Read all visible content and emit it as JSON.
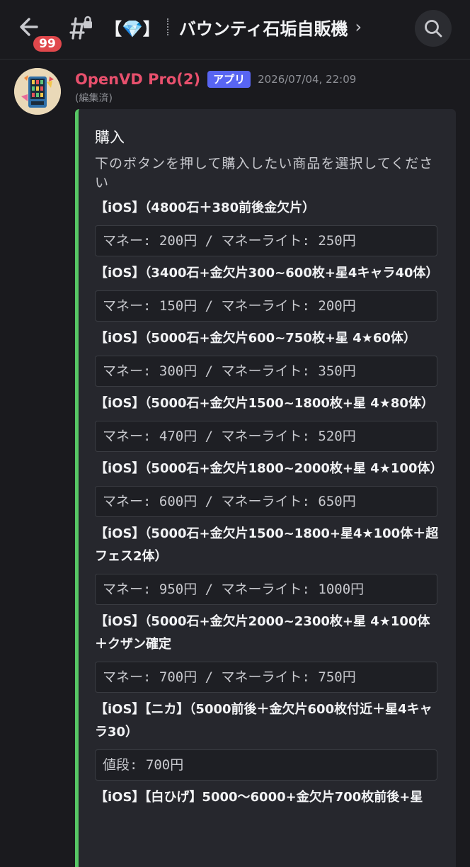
{
  "header": {
    "badge_count": "99",
    "channel_prefix": "【💎】",
    "channel_name": "バウンティ石垢自販機",
    "chevron": "›"
  },
  "message": {
    "author": "OpenVD Pro(2)",
    "app_tag": "アプリ",
    "timestamp": "2026/07/04, 22:09",
    "edited": "(編集済)"
  },
  "embed": {
    "accent_color": "#57c765",
    "title": "購入",
    "description": "下のボタンを押して購入したい商品を選択してください",
    "items": [
      {
        "label": "【iOS】（4800石＋380前後金欠片）",
        "price": "マネー: 200円 / マネーライト: 250円"
      },
      {
        "label": "【iOS】（3400石+金欠片300~600枚+星4キャラ40体）",
        "price": "マネー: 150円 / マネーライト: 200円"
      },
      {
        "label": "【iOS】（5000石+金欠片600~750枚+星 4★60体）",
        "price": "マネー: 300円 / マネーライト: 350円"
      },
      {
        "label": "【iOS】（5000石+金欠片1500~1800枚+星 4★80体）",
        "price": "マネー: 470円 / マネーライト: 520円"
      },
      {
        "label": "【iOS】（5000石+金欠片1800~2000枚+星 4★100体）",
        "price": "マネー: 600円 / マネーライト: 650円"
      },
      {
        "label": "【iOS】（5000石+金欠片1500~1800+星4★100体＋超フェス2体）",
        "price": "マネー: 950円 / マネーライト: 1000円"
      },
      {
        "label": "【iOS】（5000石+金欠片2000~2300枚+星 4★100体＋クザン確定",
        "price": "マネー: 700円 / マネーライト: 750円"
      },
      {
        "label": "【iOS】【ニカ】（5000前後＋金欠片600枚付近＋星4キャラ30）",
        "price": "値段: 700円"
      },
      {
        "label": "【iOS】【白ひげ】5000〜6000+金欠片700枚前後+星",
        "price": ""
      }
    ]
  }
}
